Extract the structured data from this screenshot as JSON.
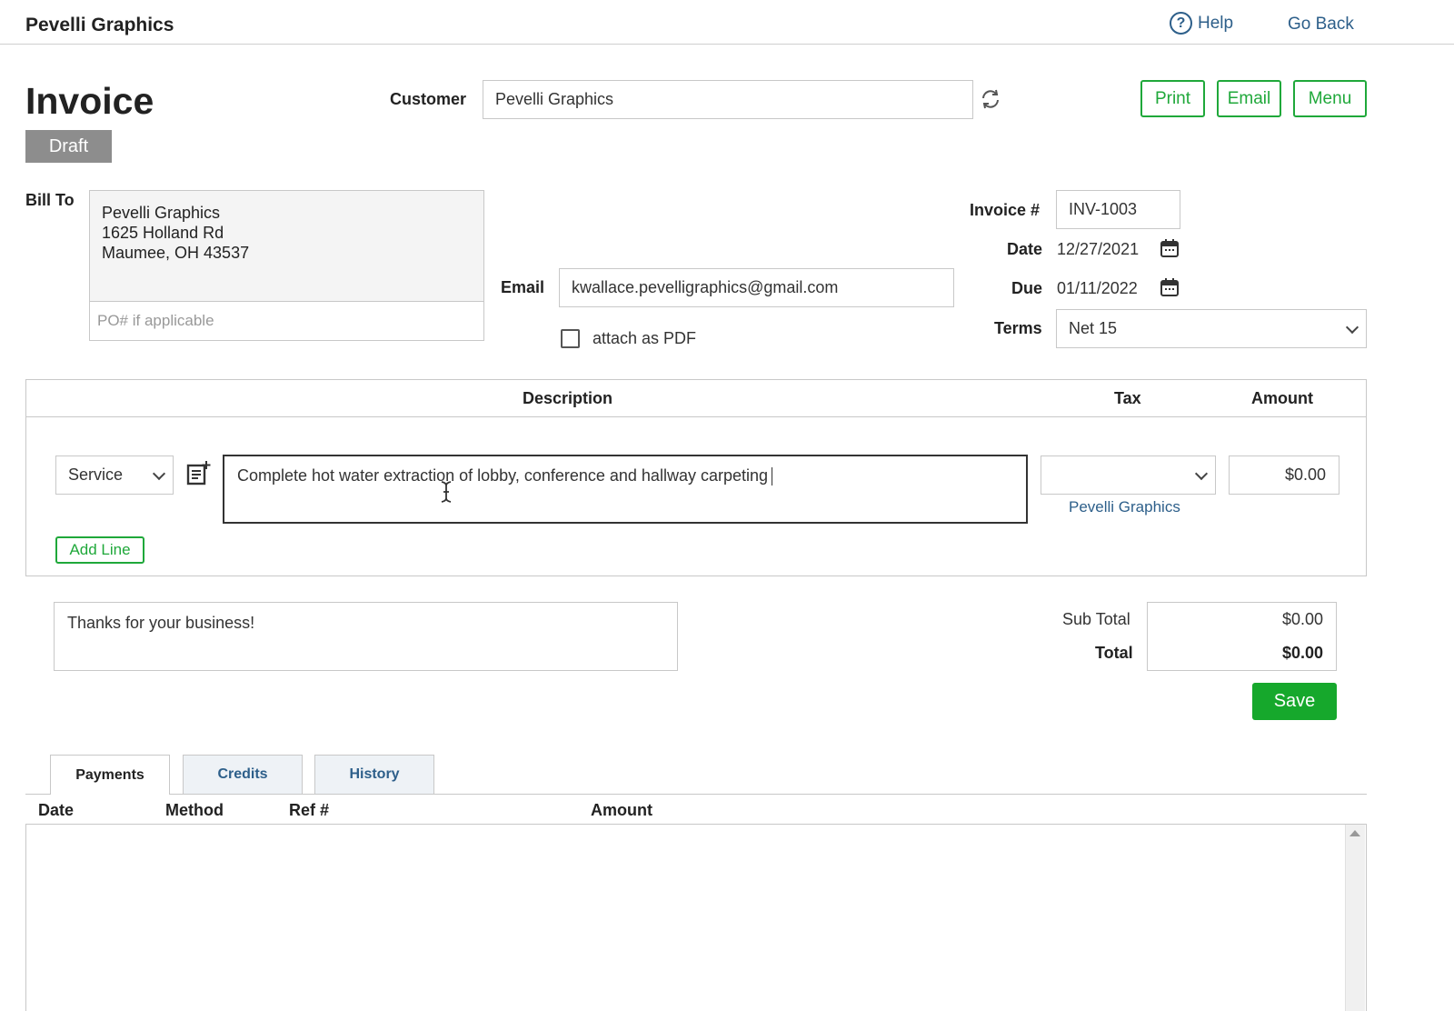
{
  "header": {
    "company": "Pevelli Graphics",
    "help_label": "Help",
    "go_back_label": "Go Back"
  },
  "invoice": {
    "title": "Invoice",
    "status": "Draft"
  },
  "customer": {
    "label": "Customer",
    "value": "Pevelli Graphics"
  },
  "actions": {
    "print": "Print",
    "email": "Email",
    "menu": "Menu"
  },
  "bill_to": {
    "label": "Bill To",
    "line1": "Pevelli Graphics",
    "line2": "1625 Holland Rd",
    "line3": "Maumee, OH 43537",
    "po_placeholder": "PO# if applicable"
  },
  "email": {
    "label": "Email",
    "value": "kwallace.pevelligraphics@gmail.com",
    "attach_pdf_label": "attach as PDF",
    "attach_pdf_checked": false
  },
  "details": {
    "invoice_no_label": "Invoice #",
    "invoice_no": "INV-1003",
    "date_label": "Date",
    "date": "12/27/2021",
    "due_label": "Due",
    "due": "01/11/2022",
    "terms_label": "Terms",
    "terms": "Net 15"
  },
  "line_items": {
    "headers": {
      "description": "Description",
      "tax": "Tax",
      "amount": "Amount"
    },
    "rows": [
      {
        "type": "Service",
        "description": "Complete hot water extraction of lobby, conference and hallway carpeting",
        "tax": "",
        "tax_note": "Pevelli Graphics",
        "amount": "$0.00"
      }
    ],
    "add_line_label": "Add Line"
  },
  "notes": "Thanks for your business!",
  "totals": {
    "subtotal_label": "Sub Total",
    "subtotal": "$0.00",
    "total_label": "Total",
    "total": "$0.00"
  },
  "save_label": "Save",
  "tabs": [
    {
      "label": "Payments",
      "active": true
    },
    {
      "label": "Credits",
      "active": false
    },
    {
      "label": "History",
      "active": false
    }
  ],
  "payments_table": {
    "headers": [
      "Date",
      "Method",
      "Ref #",
      "Amount"
    ],
    "rows": []
  },
  "colors": {
    "accent_green": "#16a82c",
    "link_blue": "#2d5f8a",
    "draft_gray": "#8d8d8d"
  }
}
